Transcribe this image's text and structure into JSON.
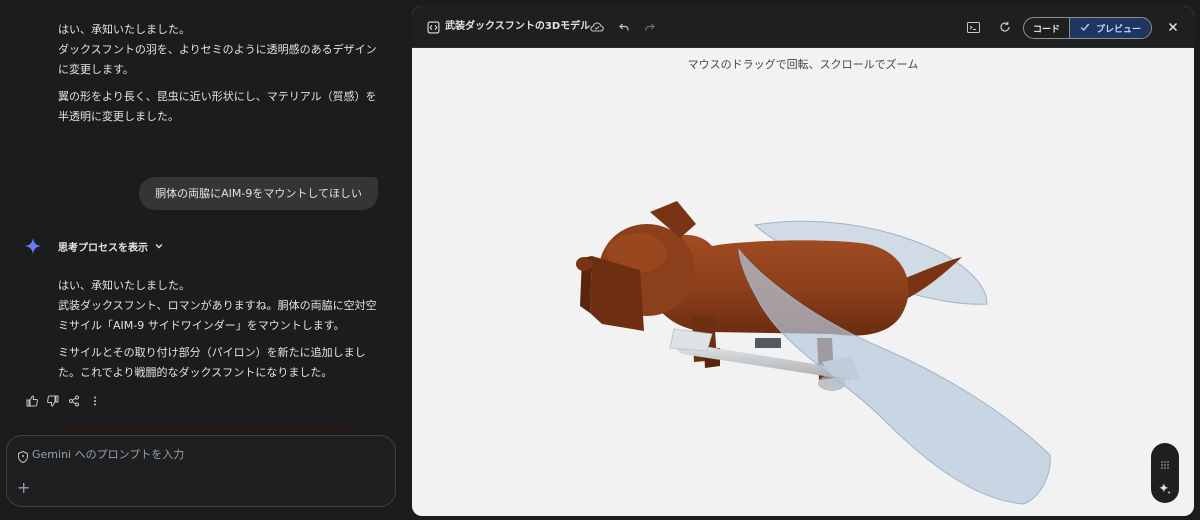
{
  "chat": {
    "first_response": {
      "paragraphs": [
        "はい、承知いたしました。\nダックスフントの羽を、よりセミのように透明感のあるデザインに変更します。",
        "翼の形をより長く、昆虫に近い形状にし、マテリアル（質感）を半透明に変更しました。"
      ]
    },
    "user_message": "胴体の両脇にAIM-9をマウントしてほしい",
    "thinking_label": "思考プロセスを表示",
    "second_response": {
      "paragraphs": [
        "はい、承知いたしました。\n武装ダックスフント、ロマンがありますね。胴体の両脇に空対空ミサイル「AIM-9 サイドワインダー」をマウントします。",
        "ミサイルとその取り付け部分（パイロン）を新たに追加しました。これでより戦闘的なダックスフントになりました。"
      ]
    },
    "action_icons": [
      "thumbs-up-icon",
      "thumbs-down-icon",
      "share-icon",
      "more-vert-icon"
    ],
    "prompt": {
      "placeholder": "Gemini へのプロンプトを入力",
      "value": ""
    }
  },
  "canvas": {
    "title": "武装ダックスフントの3Dモデル",
    "toggle": {
      "code_label": "コード",
      "preview_label": "プレビュー",
      "active": "preview"
    },
    "hint": "マウスのドラッグで回転、スクロールでズーム",
    "colors": {
      "body": "#8b3f1b",
      "body_shade": "#6e2e12",
      "wing": "#b7c9dc",
      "missile": "#cfd3d6",
      "header_bg": "#1e1f20",
      "viewport_bg": "#f2f2f2",
      "accent": "#1f3760"
    }
  }
}
